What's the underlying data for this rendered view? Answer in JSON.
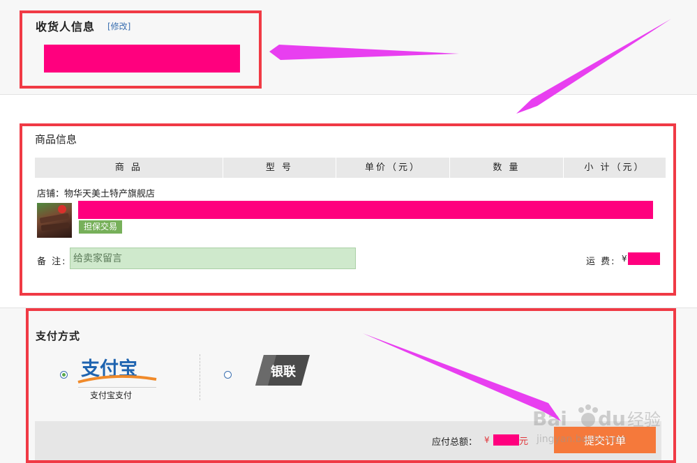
{
  "receiver": {
    "title": "收货人信息",
    "edit_label": "[修改]"
  },
  "goods": {
    "title": "商品信息",
    "columns": [
      "商 品",
      "型 号",
      "单价（元）",
      "数 量",
      "小 计（元）"
    ],
    "shop_label": "店铺：物华天美土特产旗舰店",
    "trade_badge": "担保交易",
    "remark_label": "备 注:",
    "remark_placeholder": "给卖家留言",
    "shipping_label": "运 费:",
    "shipping_currency": "¥"
  },
  "payment": {
    "title": "支付方式",
    "options": [
      {
        "label": "支付宝支付",
        "logo_text": "支付宝",
        "selected": true
      },
      {
        "label": "",
        "logo_text": "银联",
        "selected": false
      }
    ]
  },
  "footer": {
    "total_label": "应付总额：",
    "currency": "¥",
    "unit": "元",
    "submit_label": "提交订单"
  },
  "watermark": {
    "brand": "Bai",
    "brand_tail": "du",
    "service": "经验",
    "url": "jingyan.baidu.com"
  },
  "colors": {
    "highlight": "#f03a45",
    "redaction": "#ff007e",
    "arrow": "#e83ff0",
    "submit": "#f5793b",
    "badge": "#77b05a"
  }
}
